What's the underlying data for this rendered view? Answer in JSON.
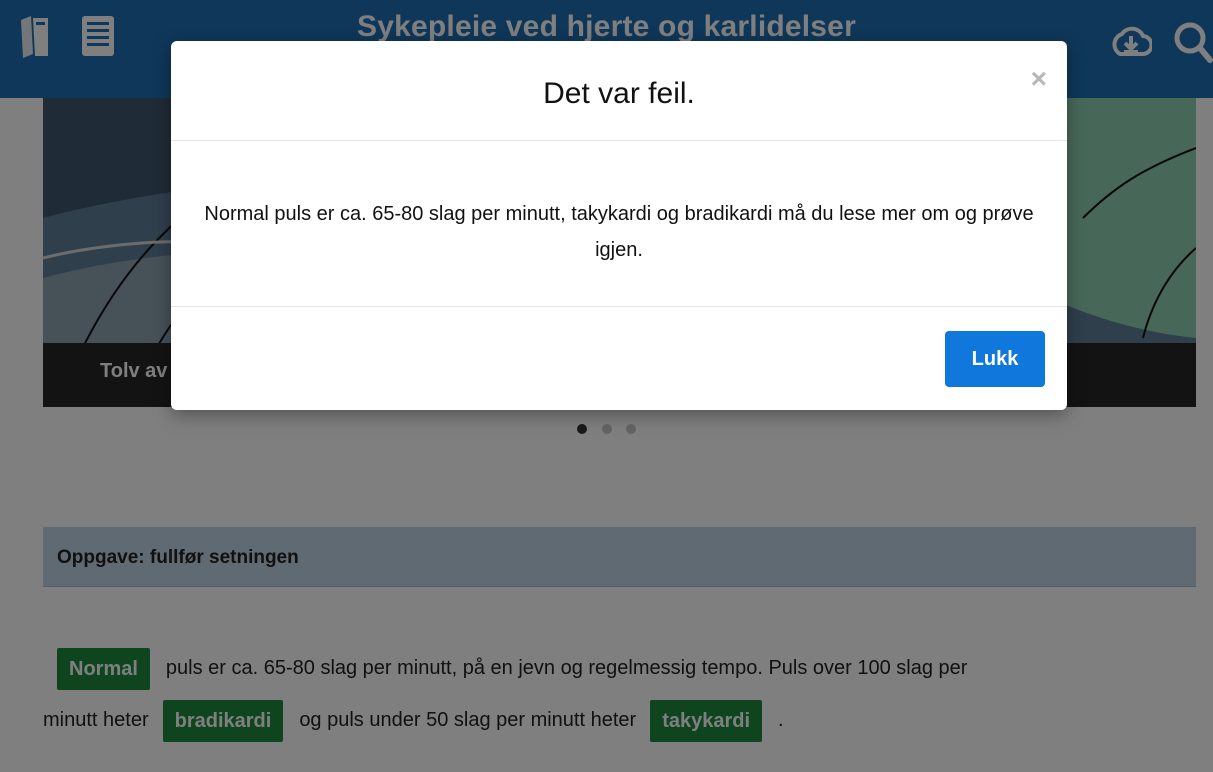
{
  "header": {
    "title": "Sykepleie ved hjerte og karlidelser",
    "left_icons": [
      "books-icon",
      "list-icon"
    ],
    "right_icons": [
      "download-icon",
      "search-icon"
    ],
    "bar_color": "#1f6fb2"
  },
  "carousel": {
    "caption": "Tolv av",
    "slide_count": 3,
    "active_slide": 1
  },
  "task": {
    "heading": "Oppgave: fullfør setningen",
    "chip1": "Normal",
    "text1": "puls er ca. 65-80 slag per minutt, på en jevn og regelmessig tempo. Puls over 100 slag per",
    "text2": "minutt heter",
    "chip2": "bradikardi",
    "text3": "og puls under 50 slag per minutt heter",
    "chip3": "takykardi",
    "text4": ".",
    "chip_color": "#1f8b3c"
  },
  "modal": {
    "title": "Det var feil.",
    "close_glyph": "×",
    "message": "Normal puls er ca. 65-80 slag per minutt, takykardi og bradikardi må du lese mer om og prøve igjen.",
    "button_label": "Lukk",
    "button_color": "#1077dc"
  }
}
